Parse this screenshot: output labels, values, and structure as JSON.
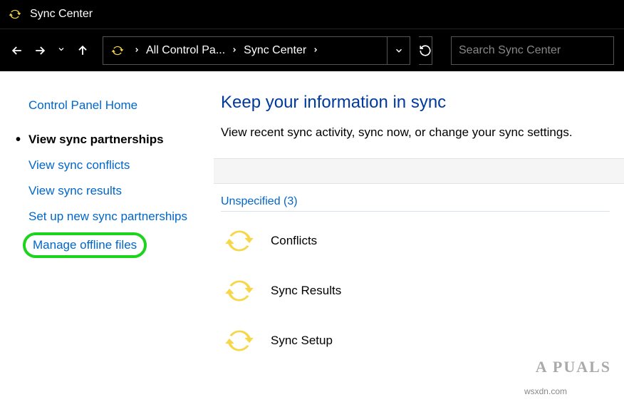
{
  "titlebar": {
    "title": "Sync Center"
  },
  "breadcrumb": {
    "item1": "All Control Pa...",
    "item2": "Sync Center"
  },
  "search": {
    "placeholder": "Search Sync Center"
  },
  "sidebar": {
    "home": "Control Panel Home",
    "view_partnerships": "View sync partnerships",
    "view_conflicts": "View sync conflicts",
    "view_results": "View sync results",
    "setup": "Set up new sync partnerships",
    "manage_offline": "Manage offline files"
  },
  "main": {
    "heading": "Keep your information in sync",
    "subtext": "View recent sync activity, sync now, or change your sync settings.",
    "group_header": "Unspecified (3)",
    "items": {
      "conflicts": "Conflicts",
      "results": "Sync Results",
      "setup": "Sync Setup"
    }
  },
  "watermark": {
    "brand": "A PUALS",
    "url": "wsxdn.com"
  }
}
